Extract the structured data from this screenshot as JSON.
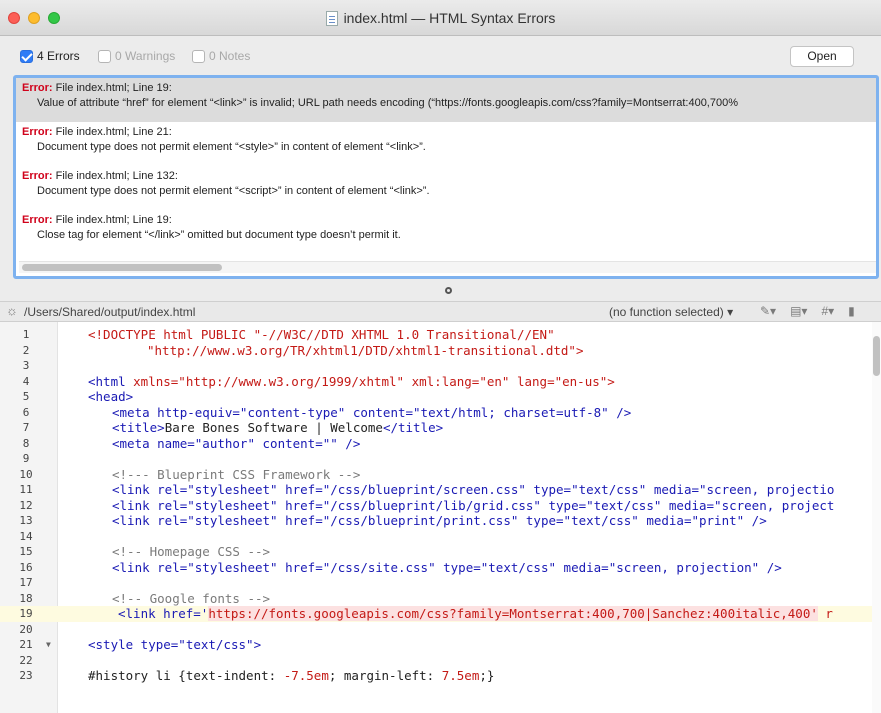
{
  "window": {
    "title": "index.html — HTML Syntax Errors"
  },
  "toolbar": {
    "errors_label": "4 Errors",
    "warnings_label": "0 Warnings",
    "notes_label": "0 Notes",
    "open_label": "Open"
  },
  "errors": [
    {
      "label": "Error:",
      "location": "File index.html; Line 19:",
      "message": "Value of attribute “href” for element “<link>” is invalid; URL path needs encoding (“https://fonts.googleapis.com/css?family=Montserrat:400,700%"
    },
    {
      "label": "Error:",
      "location": "File index.html; Line 21:",
      "message": "Document type does not permit element “<style>” in content of element “<link>”."
    },
    {
      "label": "Error:",
      "location": "File index.html; Line 132:",
      "message": "Document type does not permit element “<script>” in content of element “<link>”."
    },
    {
      "label": "Error:",
      "location": "File index.html; Line 19:",
      "message": "Close tag for element “</link>” omitted but document type doesn’t permit it."
    }
  ],
  "navbar": {
    "path": "/Users/Shared/output/index.html",
    "function_menu": "(no function selected)",
    "marker_icon": "pencil-icon",
    "doc_icon": "page-icon"
  },
  "code": {
    "line_numbers": [
      "1",
      "2",
      "3",
      "4",
      "5",
      "6",
      "7",
      "8",
      "9",
      "10",
      "11",
      "12",
      "13",
      "14",
      "15",
      "16",
      "17",
      "18",
      "19",
      "20",
      "21",
      "22",
      "23"
    ],
    "line1": "<!DOCTYPE html PUBLIC \"-//W3C//DTD XHTML 1.0 Transitional//EN\"",
    "line2": "\"http://www.w3.org/TR/xhtml1/DTD/xhtml1-transitional.dtd\">",
    "line4_tag": "<html ",
    "line4_attrs": "xmlns=\"http://www.w3.org/1999/xhtml\" xml:lang=\"en\" lang=\"en-us\">",
    "line5": "<head>",
    "line6": "<meta http-equiv=\"content-type\" content=\"text/html; charset=utf-8\" />",
    "line7_open": "<title>",
    "line7_text": "Bare Bones Software | Welcome",
    "line7_close": "</title>",
    "line8": "<meta name=\"author\" content=\"\" />",
    "line10": "<!--- Blueprint CSS Framework -->",
    "line11": "<link rel=\"stylesheet\" href=\"/css/blueprint/screen.css\" type=\"text/css\" media=\"screen, projectio",
    "line12": "<link rel=\"stylesheet\" href=\"/css/blueprint/lib/grid.css\" type=\"text/css\" media=\"screen, project",
    "line13": "<link rel=\"stylesheet\" href=\"/css/blueprint/print.css\" type=\"text/css\" media=\"print\" />",
    "line15": "<!-- Homepage CSS -->",
    "line16": "<link rel=\"stylesheet\" href=\"/css/site.css\" type=\"text/css\" media=\"screen, projection\" />",
    "line18": "<!-- Google fonts -->",
    "line19_pre": "<link href='",
    "line19_url": "https://fonts.googleapis.com/css?family=Montserrat:400,700|Sanchez:400italic,400'",
    "line19_post": " r",
    "line21": "<style type=\"text/css\">",
    "line23_sel": "#history li {",
    "line23_p1": "text-indent: ",
    "line23_v1": "-7.5em",
    "line23_p2": "; margin-left: ",
    "line23_v2": "7.5em",
    "line23_end": ";}"
  }
}
